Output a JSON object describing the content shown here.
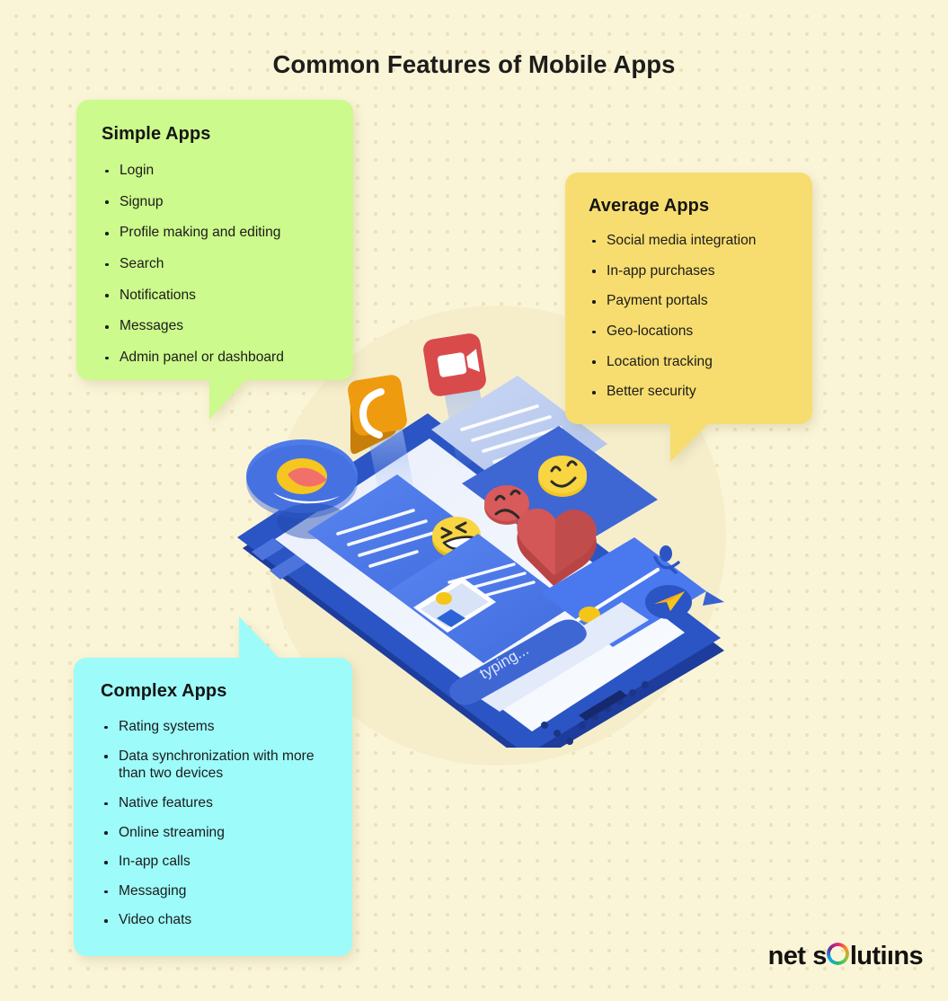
{
  "page": {
    "title": "Common Features of Mobile Apps",
    "background_color": "#FBF5D8",
    "title_color": "#1D1D1B"
  },
  "cards": [
    {
      "id": "simple",
      "heading": "Simple Apps",
      "color": "#CCFA8C",
      "items": [
        "Login",
        "Signup",
        "Profile making and editing",
        "Search",
        "Notifications",
        "Messages",
        "Admin panel or dashboard"
      ]
    },
    {
      "id": "average",
      "heading": "Average Apps",
      "color": "#F7DD6F",
      "items": [
        "Social media integration",
        "In-app purchases",
        "Payment portals",
        "Geo-locations",
        "Location tracking",
        "Better security"
      ]
    },
    {
      "id": "complex",
      "heading": "Complex Apps",
      "color": "#9DFBFA",
      "items": [
        "Rating systems",
        "Data synchronization with more than two devices",
        "Native features",
        "Online streaming",
        "In-app calls",
        "Messaging",
        "Video chats"
      ]
    }
  ],
  "logo": {
    "word1": "net",
    "word2_pre": "s",
    "word2_post": "lutiıns",
    "full_text": "net solutions"
  },
  "illustration": {
    "name": "isometric-smartphone-chat",
    "typing_label": "typing...",
    "elements": [
      "phone-call-icon-card",
      "video-camera-icon-card",
      "avatar-bubble",
      "chat-bubbles",
      "emoji-laughing",
      "emoji-sad",
      "emoji-smile",
      "heart-reaction",
      "voice-message-slider",
      "microphone-icon",
      "send-button",
      "typing-indicator"
    ],
    "colors": {
      "phone_body": "#2B55C4",
      "phone_body_dark": "#1F3E9E",
      "bubble_blue": "#4C7DF0",
      "bubble_light": "#BDCCF2",
      "screen": "#F2F5FD",
      "call_orange": "#EF9B10",
      "video_red": "#D94B4B",
      "heart_red": "#CF5050",
      "emoji_yellow": "#F5C61F",
      "accent_yellow": "#F5C518"
    }
  }
}
